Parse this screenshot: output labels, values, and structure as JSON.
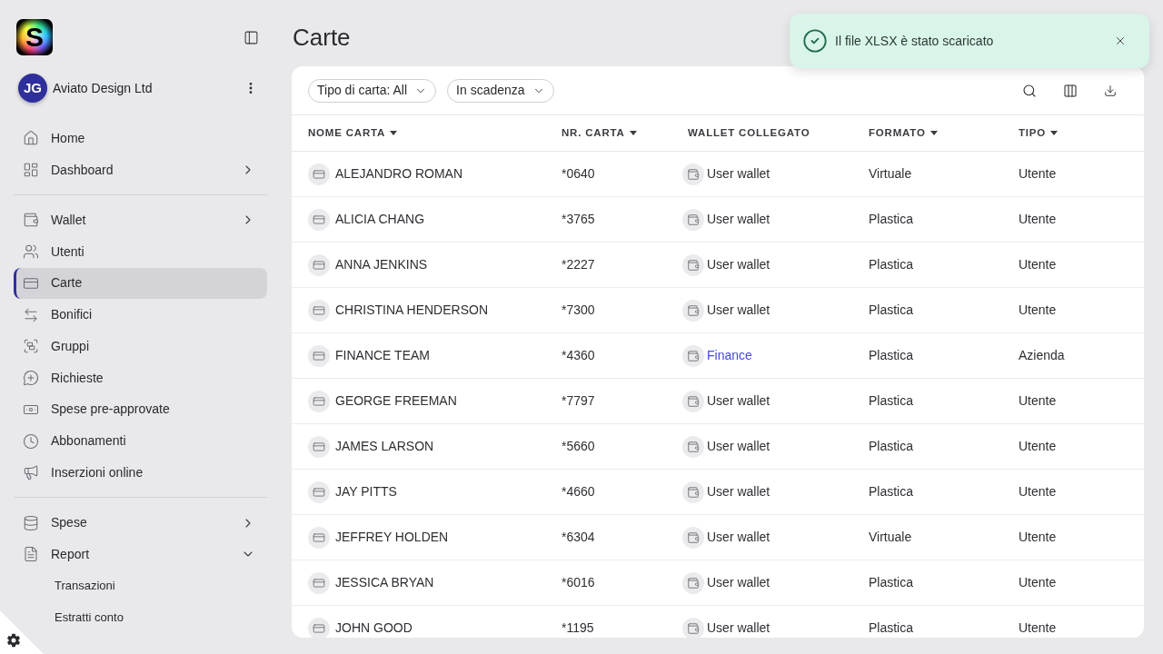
{
  "brand_mark": "S",
  "sidebar": {
    "account": {
      "initials": "JG",
      "name": "Aviato Design Ltd"
    },
    "sections": [
      {
        "items": [
          {
            "label": "Home",
            "selected": false
          },
          {
            "label": "Dashboard",
            "selected": false,
            "expanded": false
          }
        ]
      },
      {
        "items": [
          {
            "label": "Wallet",
            "selected": false,
            "expanded": false
          },
          {
            "label": "Utenti",
            "selected": false
          },
          {
            "label": "Carte",
            "selected": true
          },
          {
            "label": "Bonifici",
            "selected": false
          },
          {
            "label": "Gruppi",
            "selected": false
          },
          {
            "label": "Richieste",
            "selected": false
          },
          {
            "label": "Spese pre-approvate",
            "selected": false
          },
          {
            "label": "Abbonamenti",
            "selected": false
          },
          {
            "label": "Inserzioni online",
            "selected": false
          }
        ]
      },
      {
        "items": [
          {
            "label": "Spese",
            "selected": false,
            "expanded": false
          },
          {
            "label": "Report",
            "selected": false,
            "expanded": true,
            "children": [
              {
                "label": "Transazioni",
                "selected": false
              },
              {
                "label": "Estratti conto",
                "selected": false
              }
            ]
          }
        ]
      }
    ]
  },
  "page": {
    "title": "Carte"
  },
  "toast": {
    "message": "Il file XLSX è stato scaricato"
  },
  "table": {
    "filters": [
      {
        "label": "Tipo di carta: All"
      },
      {
        "label": "In scadenza"
      }
    ],
    "columns": [
      {
        "label": "NOME CARTA",
        "sortable": true
      },
      {
        "label": "NR. CARTA",
        "sortable": true
      },
      {
        "label": "WALLET COLLEGATO",
        "sortable": false
      },
      {
        "label": "FORMATO",
        "sortable": true
      },
      {
        "label": "TIPO",
        "sortable": true
      }
    ],
    "rows": [
      {
        "name": "ALEJANDRO ROMAN",
        "number": "*0640",
        "wallet": {
          "label": "User wallet",
          "kind": "text"
        },
        "format": "Virtuale",
        "type": "Utente"
      },
      {
        "name": "ALICIA CHANG",
        "number": "*3765",
        "wallet": {
          "label": "User wallet",
          "kind": "text"
        },
        "format": "Plastica",
        "type": "Utente"
      },
      {
        "name": "ANNA JENKINS",
        "number": "*2227",
        "wallet": {
          "label": "User wallet",
          "kind": "text"
        },
        "format": "Plastica",
        "type": "Utente"
      },
      {
        "name": "CHRISTINA HENDERSON",
        "number": "*7300",
        "wallet": {
          "label": "User wallet",
          "kind": "text"
        },
        "format": "Plastica",
        "type": "Utente"
      },
      {
        "name": "FINANCE TEAM",
        "number": "*4360",
        "wallet": {
          "label": "Finance",
          "kind": "link"
        },
        "format": "Plastica",
        "type": "Azienda"
      },
      {
        "name": "GEORGE FREEMAN",
        "number": "*7797",
        "wallet": {
          "label": "User wallet",
          "kind": "text"
        },
        "format": "Plastica",
        "type": "Utente"
      },
      {
        "name": "JAMES LARSON",
        "number": "*5660",
        "wallet": {
          "label": "User wallet",
          "kind": "text"
        },
        "format": "Plastica",
        "type": "Utente"
      },
      {
        "name": "JAY PITTS",
        "number": "*4660",
        "wallet": {
          "label": "User wallet",
          "kind": "text"
        },
        "format": "Plastica",
        "type": "Utente"
      },
      {
        "name": "JEFFREY HOLDEN",
        "number": "*6304",
        "wallet": {
          "label": "User wallet",
          "kind": "text"
        },
        "format": "Virtuale",
        "type": "Utente"
      },
      {
        "name": "JESSICA BRYAN",
        "number": "*6016",
        "wallet": {
          "label": "User wallet",
          "kind": "text"
        },
        "format": "Plastica",
        "type": "Utente"
      },
      {
        "name": "JOHN GOOD",
        "number": "*1195",
        "wallet": {
          "label": "User wallet",
          "kind": "text"
        },
        "format": "Plastica",
        "type": "Utente"
      }
    ]
  }
}
